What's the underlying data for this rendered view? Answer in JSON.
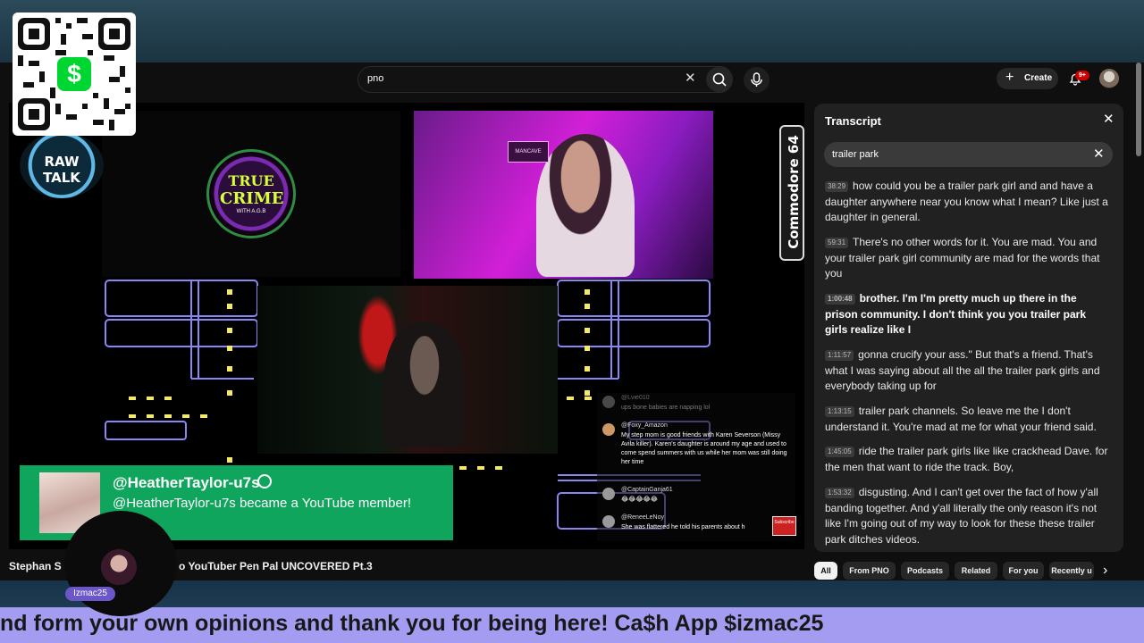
{
  "header": {
    "search_value": "pno",
    "create_label": "Create",
    "notifications_badge": "9+"
  },
  "video": {
    "true_crime_logo": {
      "line1": "TRUE",
      "line2": "CRIME",
      "line3": "WITH A.G.B"
    },
    "raw_talk_logo": "RAW TALK",
    "pink_cam_sign": "MANCAVE",
    "commodore_label": "Commodore 64",
    "member_alert": {
      "name": "@HeatherTaylor-u7s",
      "message": "@HeatherTaylor-u7s became a YouTube member!"
    },
    "chat": [
      {
        "name": "@Lvie010",
        "message": "ups bone babies are napping lol"
      },
      {
        "name": "@Foxy_Amazon",
        "message": "My step mom is good friends with Karen Severson (Missy Avila killer). Karen's daughter is around my age and used to come spend summers with us while her mom was still doing her time"
      },
      {
        "name": "@CaptainGanja61",
        "message": "😂😂😂😂😂"
      },
      {
        "name": "@ReneeLeNoy",
        "message": "She was flattered he told his parents about h"
      }
    ],
    "subscribe_badge": "Subscribe"
  },
  "below_video": {
    "title_left": "Stephan S",
    "title_right": "o YouTuber Pen Pal UNCOVERED Pt.3"
  },
  "webcam": {
    "tag": "Izmac25"
  },
  "transcript": {
    "title": "Transcript",
    "search_value": "trailer park",
    "segments": [
      {
        "time": "38:29",
        "text": "how could you be a trailer park girl and and have a daughter anywhere near you know what I mean? Like just a daughter in general.",
        "active": false
      },
      {
        "time": "59:31",
        "text": "There's no other words for it. You are mad. You and your trailer park girl community are mad for the words that you",
        "active": false
      },
      {
        "time": "1:00:48",
        "text": "brother. I'm I'm pretty much up there in the prison community. I don't think you you trailer park girls realize like I",
        "active": true
      },
      {
        "time": "1:11:57",
        "text": "gonna crucify your ass.\" But that's a friend. That's what I was saying about all the all the trailer park girls and everybody taking up for",
        "active": false
      },
      {
        "time": "1:13:15",
        "text": "trailer park channels. So leave me the I don't understand it. You're mad at me for what your friend said.",
        "active": false
      },
      {
        "time": "1:45:05",
        "text": "ride the trailer park girls like like crackhead Dave. for the men that want to ride the track. Boy,",
        "active": false
      },
      {
        "time": "1:53:32",
        "text": "disgusting. And I can't get over the fact of how y'all banding together. And y'all literally the only reason it's not like I'm going out of my way to look for these these trailer park ditches videos.",
        "active": false
      }
    ]
  },
  "chips": [
    "All",
    "From PNO",
    "Podcasts",
    "Related",
    "For you",
    "Recently u"
  ],
  "ticker": {
    "text": "nd form your own opinions and thank you for being here! Ca$h App $izmac25"
  },
  "qr": {
    "logo": "$"
  },
  "colors": {
    "member_green": "#10a55c",
    "ticker_purple": "#a49cf1",
    "cashapp_green": "#00d632",
    "badge_red": "#cc0000"
  }
}
